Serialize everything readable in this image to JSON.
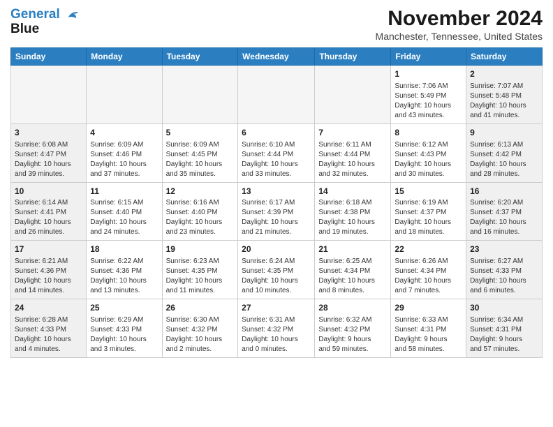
{
  "logo": {
    "line1": "General",
    "line2": "Blue"
  },
  "header": {
    "month": "November 2024",
    "location": "Manchester, Tennessee, United States"
  },
  "weekdays": [
    "Sunday",
    "Monday",
    "Tuesday",
    "Wednesday",
    "Thursday",
    "Friday",
    "Saturday"
  ],
  "weeks": [
    [
      {
        "day": "",
        "info": ""
      },
      {
        "day": "",
        "info": ""
      },
      {
        "day": "",
        "info": ""
      },
      {
        "day": "",
        "info": ""
      },
      {
        "day": "",
        "info": ""
      },
      {
        "day": "1",
        "info": "Sunrise: 7:06 AM\nSunset: 5:49 PM\nDaylight: 10 hours\nand 43 minutes."
      },
      {
        "day": "2",
        "info": "Sunrise: 7:07 AM\nSunset: 5:48 PM\nDaylight: 10 hours\nand 41 minutes."
      }
    ],
    [
      {
        "day": "3",
        "info": "Sunrise: 6:08 AM\nSunset: 4:47 PM\nDaylight: 10 hours\nand 39 minutes."
      },
      {
        "day": "4",
        "info": "Sunrise: 6:09 AM\nSunset: 4:46 PM\nDaylight: 10 hours\nand 37 minutes."
      },
      {
        "day": "5",
        "info": "Sunrise: 6:09 AM\nSunset: 4:45 PM\nDaylight: 10 hours\nand 35 minutes."
      },
      {
        "day": "6",
        "info": "Sunrise: 6:10 AM\nSunset: 4:44 PM\nDaylight: 10 hours\nand 33 minutes."
      },
      {
        "day": "7",
        "info": "Sunrise: 6:11 AM\nSunset: 4:44 PM\nDaylight: 10 hours\nand 32 minutes."
      },
      {
        "day": "8",
        "info": "Sunrise: 6:12 AM\nSunset: 4:43 PM\nDaylight: 10 hours\nand 30 minutes."
      },
      {
        "day": "9",
        "info": "Sunrise: 6:13 AM\nSunset: 4:42 PM\nDaylight: 10 hours\nand 28 minutes."
      }
    ],
    [
      {
        "day": "10",
        "info": "Sunrise: 6:14 AM\nSunset: 4:41 PM\nDaylight: 10 hours\nand 26 minutes."
      },
      {
        "day": "11",
        "info": "Sunrise: 6:15 AM\nSunset: 4:40 PM\nDaylight: 10 hours\nand 24 minutes."
      },
      {
        "day": "12",
        "info": "Sunrise: 6:16 AM\nSunset: 4:40 PM\nDaylight: 10 hours\nand 23 minutes."
      },
      {
        "day": "13",
        "info": "Sunrise: 6:17 AM\nSunset: 4:39 PM\nDaylight: 10 hours\nand 21 minutes."
      },
      {
        "day": "14",
        "info": "Sunrise: 6:18 AM\nSunset: 4:38 PM\nDaylight: 10 hours\nand 19 minutes."
      },
      {
        "day": "15",
        "info": "Sunrise: 6:19 AM\nSunset: 4:37 PM\nDaylight: 10 hours\nand 18 minutes."
      },
      {
        "day": "16",
        "info": "Sunrise: 6:20 AM\nSunset: 4:37 PM\nDaylight: 10 hours\nand 16 minutes."
      }
    ],
    [
      {
        "day": "17",
        "info": "Sunrise: 6:21 AM\nSunset: 4:36 PM\nDaylight: 10 hours\nand 14 minutes."
      },
      {
        "day": "18",
        "info": "Sunrise: 6:22 AM\nSunset: 4:36 PM\nDaylight: 10 hours\nand 13 minutes."
      },
      {
        "day": "19",
        "info": "Sunrise: 6:23 AM\nSunset: 4:35 PM\nDaylight: 10 hours\nand 11 minutes."
      },
      {
        "day": "20",
        "info": "Sunrise: 6:24 AM\nSunset: 4:35 PM\nDaylight: 10 hours\nand 10 minutes."
      },
      {
        "day": "21",
        "info": "Sunrise: 6:25 AM\nSunset: 4:34 PM\nDaylight: 10 hours\nand 8 minutes."
      },
      {
        "day": "22",
        "info": "Sunrise: 6:26 AM\nSunset: 4:34 PM\nDaylight: 10 hours\nand 7 minutes."
      },
      {
        "day": "23",
        "info": "Sunrise: 6:27 AM\nSunset: 4:33 PM\nDaylight: 10 hours\nand 6 minutes."
      }
    ],
    [
      {
        "day": "24",
        "info": "Sunrise: 6:28 AM\nSunset: 4:33 PM\nDaylight: 10 hours\nand 4 minutes."
      },
      {
        "day": "25",
        "info": "Sunrise: 6:29 AM\nSunset: 4:33 PM\nDaylight: 10 hours\nand 3 minutes."
      },
      {
        "day": "26",
        "info": "Sunrise: 6:30 AM\nSunset: 4:32 PM\nDaylight: 10 hours\nand 2 minutes."
      },
      {
        "day": "27",
        "info": "Sunrise: 6:31 AM\nSunset: 4:32 PM\nDaylight: 10 hours\nand 0 minutes."
      },
      {
        "day": "28",
        "info": "Sunrise: 6:32 AM\nSunset: 4:32 PM\nDaylight: 9 hours\nand 59 minutes."
      },
      {
        "day": "29",
        "info": "Sunrise: 6:33 AM\nSunset: 4:31 PM\nDaylight: 9 hours\nand 58 minutes."
      },
      {
        "day": "30",
        "info": "Sunrise: 6:34 AM\nSunset: 4:31 PM\nDaylight: 9 hours\nand 57 minutes."
      }
    ]
  ]
}
